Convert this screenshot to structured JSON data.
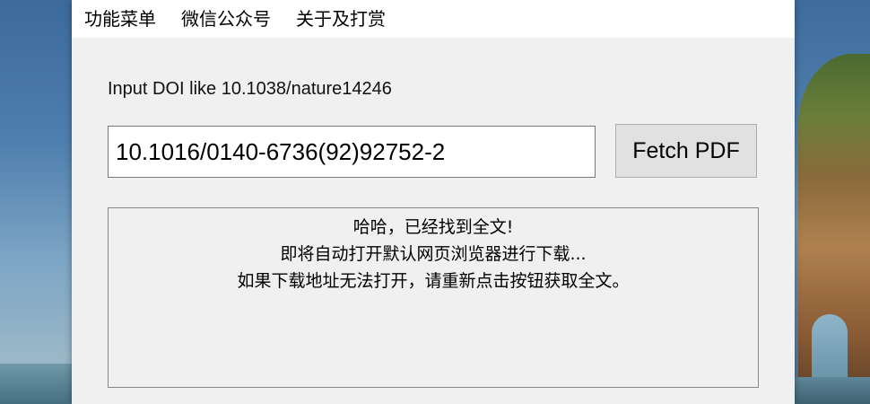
{
  "menu": {
    "items": [
      {
        "label": "功能菜单"
      },
      {
        "label": "微信公众号"
      },
      {
        "label": "关于及打赏"
      }
    ]
  },
  "main": {
    "hint_label": "Input DOI like 10.1038/nature14246",
    "doi_input_value": "10.1016/0140-6736(92)92752-2",
    "fetch_button_label": "Fetch PDF",
    "output_lines": [
      "哈哈，已经找到全文!",
      "即将自动打开默认网页浏览器进行下载...",
      "如果下载地址无法打开，请重新点击按钮获取全文。"
    ]
  },
  "colors": {
    "window_bg": "#f0f0f0",
    "menubar_bg": "#ffffff",
    "button_bg": "#e1e1e1"
  }
}
